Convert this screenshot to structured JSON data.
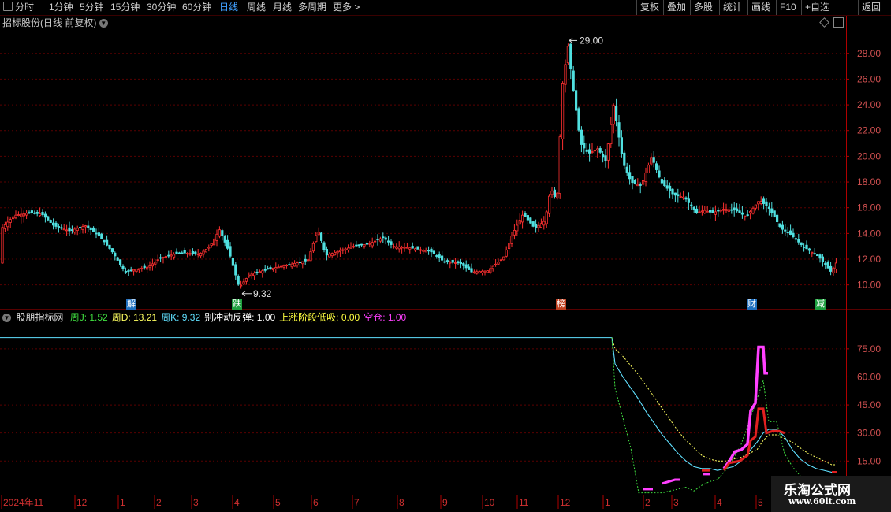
{
  "toolbar": {
    "periods": [
      {
        "label": "分时",
        "active": false
      },
      {
        "label": "1分钟",
        "active": false
      },
      {
        "label": "5分钟",
        "active": false
      },
      {
        "label": "15分钟",
        "active": false
      },
      {
        "label": "30分钟",
        "active": false
      },
      {
        "label": "60分钟",
        "active": false
      },
      {
        "label": "日线",
        "active": true
      },
      {
        "label": "周线",
        "active": false
      },
      {
        "label": "月线",
        "active": false
      },
      {
        "label": "多周期",
        "active": false
      },
      {
        "label": "更多 >",
        "active": false
      }
    ],
    "buttons": [
      "复权",
      "叠加",
      "多股",
      "统计",
      "画线",
      "F10",
      "+自选",
      "返回"
    ]
  },
  "main_chart": {
    "title": "招标股份(日线 前复权)",
    "y_ticks": [
      "28.00",
      "26.00",
      "24.00",
      "22.00",
      "20.00",
      "18.00",
      "16.00",
      "14.00",
      "12.00",
      "10.00"
    ],
    "y_range": [
      9.0,
      29.7
    ],
    "high_label": "29.00",
    "low_label": "9.32",
    "events": [
      {
        "text": "解",
        "color": "#2070c0"
      },
      {
        "text": "跌",
        "color": "#20a040"
      },
      {
        "text": "榜",
        "color": "#c04020"
      },
      {
        "text": "财",
        "color": "#2070c0"
      },
      {
        "text": "减",
        "color": "#20a040"
      }
    ]
  },
  "indicator": {
    "name": "股朋指标网",
    "values": [
      {
        "label": "周J: 1.52",
        "color": "#40e040"
      },
      {
        "label": "周D: 13.21",
        "color": "#ffff60"
      },
      {
        "label": "周K: 9.32",
        "color": "#60e0ff"
      },
      {
        "label": "别冲动反弹: 1.00",
        "color": "#ffffff"
      },
      {
        "label": "上涨阶段低吸: 0.00",
        "color": "#ffff40"
      },
      {
        "label": "空仓: 1.00",
        "color": "#ff40ff"
      }
    ],
    "y_ticks": [
      "75.00",
      "60.00",
      "45.00",
      "30.00",
      "15.00"
    ],
    "y_range": [
      -3,
      88
    ]
  },
  "x_axis": {
    "labels": [
      "2024年11",
      "12",
      "1",
      "2",
      "3",
      "4",
      "5",
      "6",
      "7",
      "8",
      "9",
      "10",
      "11",
      "12",
      "1",
      "2",
      "3",
      "4",
      "5"
    ]
  },
  "watermark": {
    "line1": "乐淘公式网",
    "line2": "www.60lt.com"
  },
  "colors": {
    "up": "#ff3030",
    "down": "#50e0e0",
    "grid": "#5a0000",
    "axis": "#a00000"
  }
}
